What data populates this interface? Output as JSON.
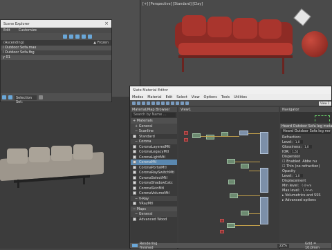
{
  "left_viewport": {
    "label": ""
  },
  "right_viewport": {
    "label": "[+] [Perspective] [Standard] [Clay]"
  },
  "scene_explorer": {
    "title": "Scene Explorer",
    "close": "×",
    "menu": [
      "Edit",
      "Customize"
    ],
    "col_name": "(Ascending)",
    "col_frozen": "▲ Frozen",
    "rows": [
      "l Outdoor Sofa.max",
      "l Outdoor Sofa.fbg",
      "y 01"
    ],
    "selection_set": "Selection Set:"
  },
  "sme": {
    "title": "Slate Material Editor",
    "menu": [
      "Modes",
      "Material",
      "Edit",
      "Select",
      "View",
      "Options",
      "Tools",
      "Utilities"
    ],
    "browser_title": "Material/Map Browser",
    "search": "Search by Name ...",
    "tree": [
      {
        "kind": "cat",
        "label": "+ Materials"
      },
      {
        "kind": "sub",
        "label": "+ General"
      },
      {
        "kind": "sub",
        "label": "− Scanline"
      },
      {
        "kind": "item",
        "label": "Standard"
      },
      {
        "kind": "sub",
        "label": "− Corona"
      },
      {
        "kind": "item",
        "label": "CoronaLayeredMtl"
      },
      {
        "kind": "item",
        "label": "CoronaLegacyMtl"
      },
      {
        "kind": "item",
        "label": "CoronaLightMtl"
      },
      {
        "kind": "item",
        "label": "CoronaMtl",
        "sel": true
      },
      {
        "kind": "item",
        "label": "CoronaPortalMtl"
      },
      {
        "kind": "item",
        "label": "CoronaRaySwitchMtl"
      },
      {
        "kind": "item",
        "label": "CoronaSelectMtl"
      },
      {
        "kind": "item",
        "label": "CoronaShadowCatc"
      },
      {
        "kind": "item",
        "label": "CoronaSkinMtl"
      },
      {
        "kind": "item",
        "label": "CoronaVolumeMtl"
      },
      {
        "kind": "sub",
        "label": "− V-Ray"
      },
      {
        "kind": "item",
        "label": "VRayMtl"
      },
      {
        "kind": "cat",
        "label": "− Maps"
      },
      {
        "kind": "sub",
        "label": "− General"
      },
      {
        "kind": "item",
        "label": "Advanced Wood"
      }
    ],
    "view_title": "View1",
    "nav_title": "Navigator",
    "view_tab": "View 1",
    "props_title": "Heard Outdoor Sofa leg metall",
    "props_name": "Heard Outdoor Sofa leg metall",
    "props": [
      {
        "label": "Refraction:"
      },
      {
        "label": "Level:",
        "val": "1,0"
      },
      {
        "label": "Glossiness:",
        "val": "1,0"
      },
      {
        "label": "IOR:",
        "val": "1,52"
      },
      {
        "label": "Dispersion"
      },
      {
        "label": "☐ Enabled",
        "extra": "Abbe nu"
      },
      {
        "label": "☐ Thin (no refraction)"
      },
      {
        "label": "Opacity"
      },
      {
        "label": "Level:",
        "val": "1,0"
      },
      {
        "label": "Displacement"
      },
      {
        "label": "Min level:",
        "val": "0,0mm"
      },
      {
        "label": "Max level:",
        "val": "1,0mm"
      },
      {
        "label": "▸ Volumetrics and SSS"
      },
      {
        "label": "▸ Advanced options"
      }
    ],
    "status": "Rendering finished",
    "zoom": "22%",
    "readout": "Grid = 10,0mm"
  },
  "colors": {
    "accent": "#6aa7d8",
    "selected": "#5a88b0",
    "red_sofa": "#a9352d"
  }
}
